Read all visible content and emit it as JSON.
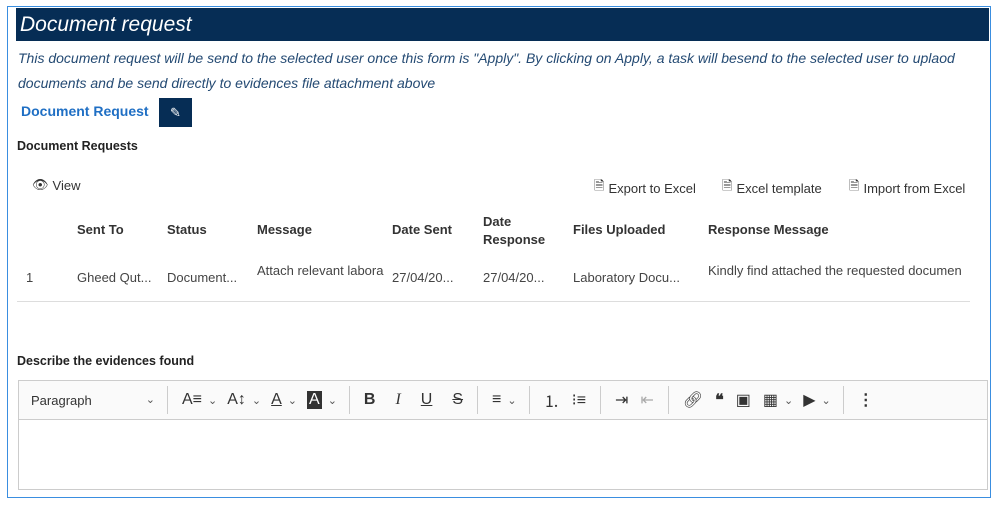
{
  "header": {
    "title": "Document request"
  },
  "description": "This document request will be send to the selected user once this form is \"Apply\". By clicking on Apply, a task will besend to the selected user to uplaod documents and be send directly to evidences file attachment above",
  "document_request_label": "Document Request",
  "section_title": "Document Requests",
  "toolbar": {
    "view": "View",
    "export": "Export to Excel",
    "template": "Excel template",
    "import": "Import from Excel"
  },
  "table": {
    "headers": [
      "Sent To",
      "Status",
      "Message",
      "Date Sent",
      "Date Response",
      "Files Uploaded",
      "Response Message"
    ],
    "rows": [
      [
        "1",
        "Gheed Qut...",
        "Document...",
        "Attach relevant labora",
        "27/04/20...",
        "27/04/20...",
        "Laboratory Docu...",
        "Kindly find attached the requested documen"
      ]
    ]
  },
  "evidence_label": "Describe the evidences found",
  "editor": {
    "paragraph": "Paragraph"
  }
}
